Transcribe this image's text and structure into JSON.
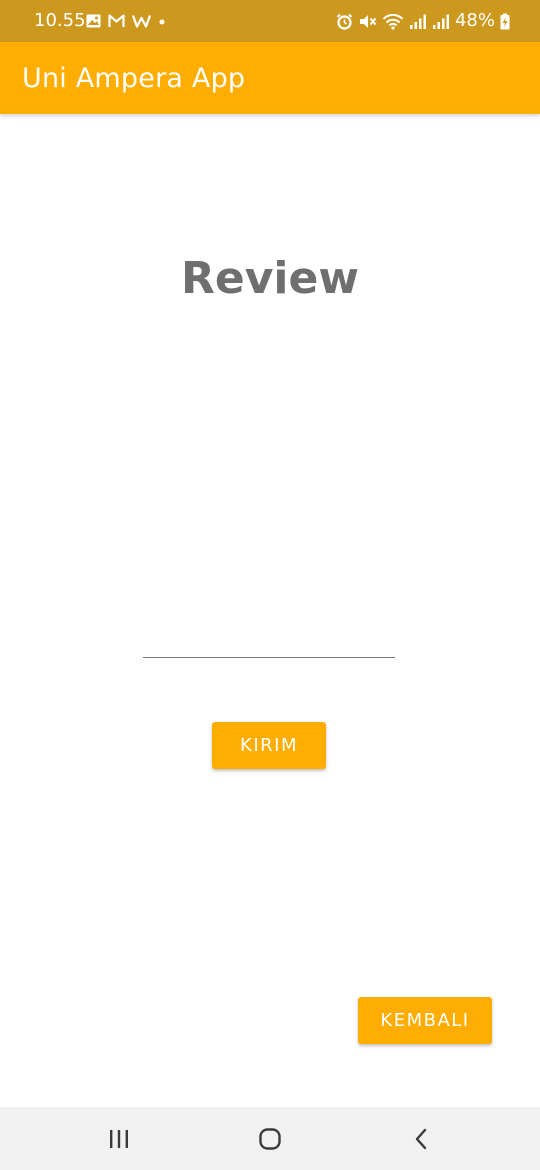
{
  "status_bar": {
    "time": "10.55",
    "battery": "48%",
    "left_icons": [
      "image-icon",
      "gmail-icon",
      "w-app-icon",
      "dot-icon"
    ],
    "right_icons": [
      "alarm-icon",
      "mute-icon",
      "wifi-icon",
      "signal-icon",
      "signal-icon",
      "battery-charging-icon"
    ]
  },
  "app_bar": {
    "title": "Uni Ampera App"
  },
  "main": {
    "heading": "Review",
    "review_input": {
      "value": "",
      "placeholder": ""
    },
    "submit_label": "KIRIM",
    "back_label": "KEMBALI"
  },
  "nav_bar": {
    "icons": [
      "recent-apps-icon",
      "home-icon",
      "back-icon"
    ]
  },
  "colors": {
    "status_bar": "#CC991E",
    "accent": "#FFAD00",
    "heading": "#6F6F6F",
    "nav_bar": "#F1F1F1"
  }
}
